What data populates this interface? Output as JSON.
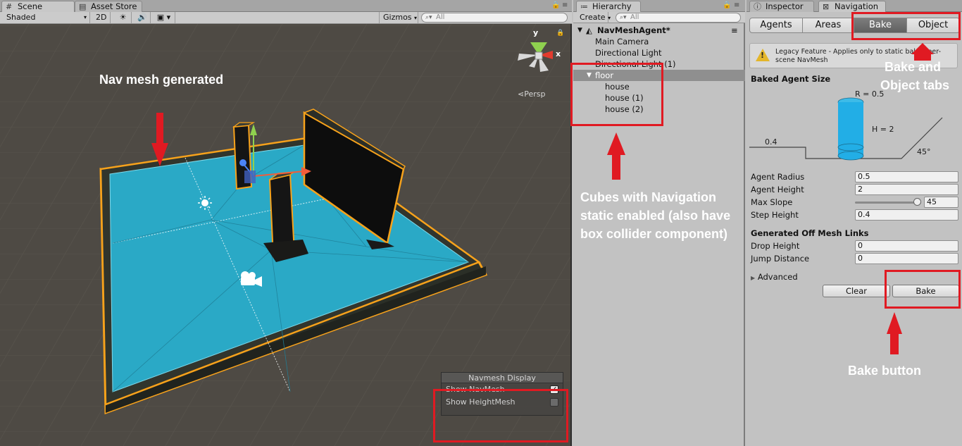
{
  "scene_tabs": {
    "scene": "Scene",
    "asset_store": "Asset Store"
  },
  "scene_toolbar": {
    "shading": "Shaded",
    "mode_2d": "2D",
    "gizmos": "Gizmos",
    "search_placeholder": "All",
    "persp": "Persp",
    "axis_x": "x",
    "axis_y": "y"
  },
  "navmesh_display": {
    "title": "Navmesh Display",
    "show_navmesh": "Show NavMesh",
    "show_navmesh_checked": true,
    "show_heightmesh": "Show HeightMesh",
    "show_heightmesh_checked": false
  },
  "hierarchy": {
    "tab": "Hierarchy",
    "create": "Create",
    "search_placeholder": "All",
    "scene_name": "NavMeshAgent*",
    "items": [
      {
        "label": "Main Camera",
        "indent": 0
      },
      {
        "label": "Directional Light",
        "indent": 0
      },
      {
        "label": "Directional Light (1)",
        "indent": 0
      },
      {
        "label": "floor",
        "indent": 0
      },
      {
        "label": "house",
        "indent": 1
      },
      {
        "label": "house (1)",
        "indent": 1
      },
      {
        "label": "house (2)",
        "indent": 1
      }
    ]
  },
  "navigation": {
    "inspector_tab": "Inspector",
    "navigation_tab": "Navigation",
    "tabs": [
      "Agents",
      "Areas",
      "Bake",
      "Object"
    ],
    "active_tab": "Bake",
    "warning": "Legacy Feature - Applies only to static baked per-scene NavMesh",
    "baked_agent_size": "Baked Agent Size",
    "diagram": {
      "radius": "R = 0.5",
      "height": "H = 2",
      "step": "0.4",
      "slope": "45°"
    },
    "fields": [
      {
        "label": "Agent Radius",
        "value": "0.5"
      },
      {
        "label": "Agent Height",
        "value": "2"
      },
      {
        "label": "Max Slope",
        "value": "45",
        "slider_fraction": 1.0
      },
      {
        "label": "Step Height",
        "value": "0.4"
      }
    ],
    "off_mesh_title": "Generated Off Mesh Links",
    "off_mesh_fields": [
      {
        "label": "Drop Height",
        "value": "0"
      },
      {
        "label": "Jump Distance",
        "value": "0"
      }
    ],
    "advanced": "Advanced",
    "clear_button": "Clear",
    "bake_button": "Bake"
  },
  "annotations": {
    "nav_mesh_generated": "Nav mesh generated",
    "cubes_line1": "Cubes with Navigation",
    "cubes_line2": "static enabled (also have",
    "cubes_line3": "box collider component)",
    "tabs_line1": "Bake and",
    "tabs_line2": "Object tabs",
    "bake_button": "Bake button"
  },
  "colors": {
    "annotation_red": "#e01a22",
    "navmesh_blue": "#2aa9c6",
    "selection_orange": "#f7a21b"
  }
}
